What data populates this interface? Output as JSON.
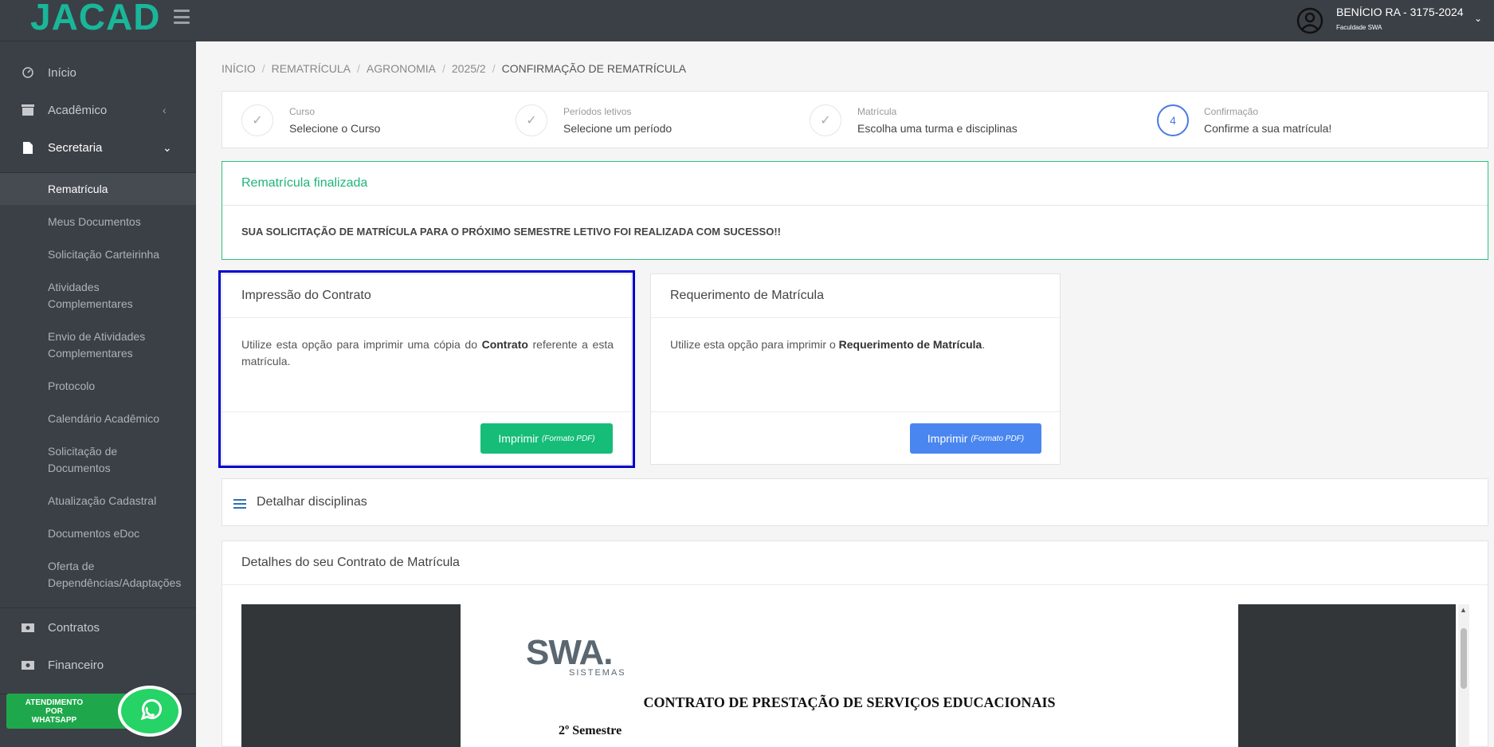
{
  "logo": {
    "text": "JACAD"
  },
  "user": {
    "name": "BENÍCIO RA - 3175-2024",
    "institution": "Faculdade SWA"
  },
  "sidebar": {
    "main_items": [
      {
        "label": "Início",
        "icon": "dashboard-icon"
      },
      {
        "label": "Acadêmico",
        "icon": "archive-icon"
      },
      {
        "label": "Secretaria",
        "icon": "document-icon"
      }
    ],
    "sub_items": [
      "Rematrícula",
      "Meus Documentos",
      "Solicitação Carteirinha",
      "Atividades Complementares",
      "Envio de Atividades Complementares",
      "Protocolo",
      "Calendário Acadêmico",
      "Solicitação de Documentos",
      "Atualização Cadastral",
      "Documentos eDoc",
      "Oferta de Dependências/Adaptações"
    ],
    "bottom_items": [
      {
        "label": "Contratos",
        "icon": "money-icon"
      },
      {
        "label": "Financeiro",
        "icon": "money-icon"
      }
    ],
    "whatsapp": {
      "line1": "ATENDIMENTO",
      "line2": "POR",
      "line3": "WHATSAPP"
    }
  },
  "breadcrumb": [
    "INÍCIO",
    "REMATRÍCULA",
    "AGRONOMIA",
    "2025/2",
    "CONFIRMAÇÃO DE REMATRÍCULA"
  ],
  "steps": [
    {
      "small": "Curso",
      "big": "Selecione o Curso",
      "marker": "✓"
    },
    {
      "small": "Períodos letivos",
      "big": "Selecione um período",
      "marker": "✓"
    },
    {
      "small": "Matrícula",
      "big": "Escolha uma turma e disciplinas",
      "marker": "✓"
    },
    {
      "small": "Confirmação",
      "big": "Confirme a sua matrícula!",
      "marker": "4"
    }
  ],
  "success": {
    "title": "Rematrícula finalizada",
    "message": "SUA SOLICITAÇÃO DE MATRÍCULA PARA O PRÓXIMO SEMESTRE LETIVO FOI REALIZADA COM SUCESSO!!"
  },
  "contract_panel": {
    "title": "Impressão do Contrato",
    "text_before": "Utilize esta opção para imprimir uma cópia do ",
    "text_bold": "Contrato",
    "text_after": " referente a esta matrícula.",
    "button_label": "Imprimir",
    "button_note": "(Formato PDF)"
  },
  "requirement_panel": {
    "title": "Requerimento de Matrícula",
    "text_before": "Utilize esta opção para imprimir o ",
    "text_bold": "Requerimento de Matrícula",
    "text_after": ".",
    "button_label": "Imprimir",
    "button_note": "(Formato PDF)"
  },
  "disciplines": {
    "title": "Detalhar disciplinas"
  },
  "contract_details": {
    "title": "Detalhes do seu Contrato de Matrícula",
    "pdf_logo": "SWA.",
    "pdf_logo_sub": "SISTEMAS",
    "pdf_heading": "CONTRATO DE PRESTAÇÃO DE SERVIÇOS EDUCACIONAIS",
    "pdf_semester": "2º Semestre"
  },
  "colors": {
    "accent_green": "#15bd79",
    "accent_blue": "#4a86f0",
    "sidebar_bg": "#3b4046",
    "highlight": "#0000cc"
  }
}
